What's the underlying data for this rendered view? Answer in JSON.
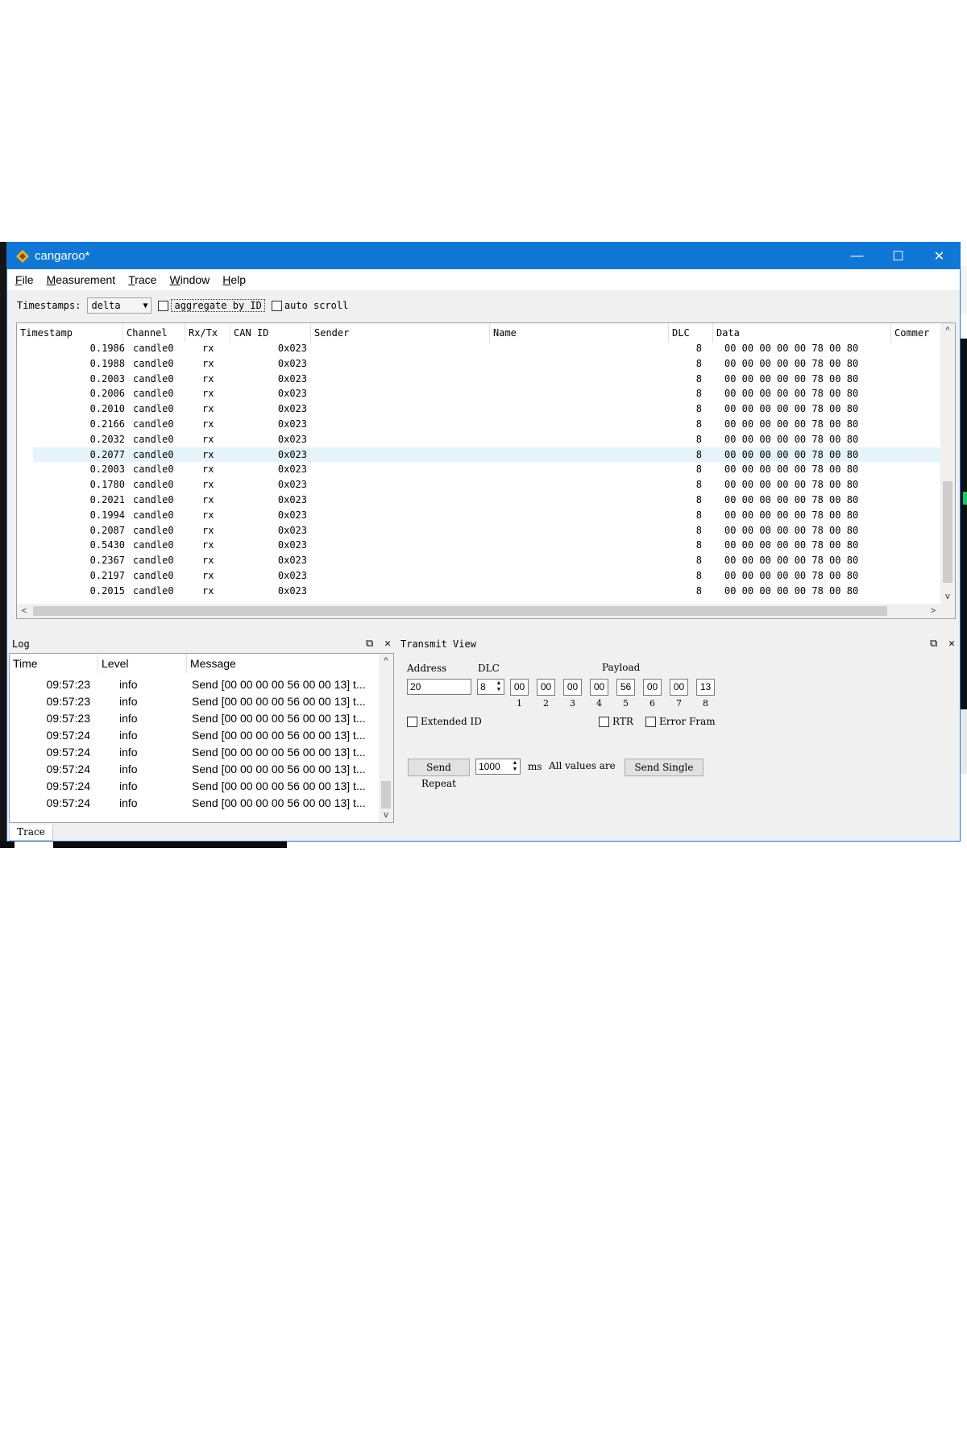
{
  "window": {
    "title": "cangaroo*"
  },
  "titlebar_buttons": {
    "minimize": "—",
    "maximize": "☐",
    "close": "✕"
  },
  "menu": [
    {
      "mnemonic": "F",
      "rest": "ile"
    },
    {
      "mnemonic": "M",
      "rest": "easurement"
    },
    {
      "mnemonic": "T",
      "rest": "race"
    },
    {
      "mnemonic": "W",
      "rest": "indow"
    },
    {
      "mnemonic": "H",
      "rest": "elp"
    }
  ],
  "toolbar": {
    "timestamps_label": "Timestamps:",
    "timestamps_value": "delta",
    "aggregate_label": "aggregate by ID",
    "autoscroll_label": "auto scroll"
  },
  "trace": {
    "columns": [
      "Timestamp",
      "Channel",
      "Rx/Tx",
      "CAN ID",
      "Sender",
      "Name",
      "DLC",
      "Data",
      "Commer"
    ],
    "rows": [
      {
        "ts": "0.1986",
        "ch": "candle0",
        "dir": "rx",
        "id": "0x023",
        "dlc": "8",
        "data": "00 00 00 00 00 78 00 80"
      },
      {
        "ts": "0.1988",
        "ch": "candle0",
        "dir": "rx",
        "id": "0x023",
        "dlc": "8",
        "data": "00 00 00 00 00 78 00 80"
      },
      {
        "ts": "0.2003",
        "ch": "candle0",
        "dir": "rx",
        "id": "0x023",
        "dlc": "8",
        "data": "00 00 00 00 00 78 00 80"
      },
      {
        "ts": "0.2006",
        "ch": "candle0",
        "dir": "rx",
        "id": "0x023",
        "dlc": "8",
        "data": "00 00 00 00 00 78 00 80"
      },
      {
        "ts": "0.2010",
        "ch": "candle0",
        "dir": "rx",
        "id": "0x023",
        "dlc": "8",
        "data": "00 00 00 00 00 78 00 80"
      },
      {
        "ts": "0.2166",
        "ch": "candle0",
        "dir": "rx",
        "id": "0x023",
        "dlc": "8",
        "data": "00 00 00 00 00 78 00 80"
      },
      {
        "ts": "0.2032",
        "ch": "candle0",
        "dir": "rx",
        "id": "0x023",
        "dlc": "8",
        "data": "00 00 00 00 00 78 00 80"
      },
      {
        "ts": "0.2077",
        "ch": "candle0",
        "dir": "rx",
        "id": "0x023",
        "dlc": "8",
        "data": "00 00 00 00 00 78 00 80",
        "selected": true
      },
      {
        "ts": "0.2003",
        "ch": "candle0",
        "dir": "rx",
        "id": "0x023",
        "dlc": "8",
        "data": "00 00 00 00 00 78 00 80"
      },
      {
        "ts": "0.1780",
        "ch": "candle0",
        "dir": "rx",
        "id": "0x023",
        "dlc": "8",
        "data": "00 00 00 00 00 78 00 80"
      },
      {
        "ts": "0.2021",
        "ch": "candle0",
        "dir": "rx",
        "id": "0x023",
        "dlc": "8",
        "data": "00 00 00 00 00 78 00 80"
      },
      {
        "ts": "0.1994",
        "ch": "candle0",
        "dir": "rx",
        "id": "0x023",
        "dlc": "8",
        "data": "00 00 00 00 00 78 00 80"
      },
      {
        "ts": "0.2087",
        "ch": "candle0",
        "dir": "rx",
        "id": "0x023",
        "dlc": "8",
        "data": "00 00 00 00 00 78 00 80"
      },
      {
        "ts": "0.5430",
        "ch": "candle0",
        "dir": "rx",
        "id": "0x023",
        "dlc": "8",
        "data": "00 00 00 00 00 78 00 80"
      },
      {
        "ts": "0.2367",
        "ch": "candle0",
        "dir": "rx",
        "id": "0x023",
        "dlc": "8",
        "data": "00 00 00 00 00 78 00 80"
      },
      {
        "ts": "0.2197",
        "ch": "candle0",
        "dir": "rx",
        "id": "0x023",
        "dlc": "8",
        "data": "00 00 00 00 00 78 00 80"
      },
      {
        "ts": "0.2015",
        "ch": "candle0",
        "dir": "rx",
        "id": "0x023",
        "dlc": "8",
        "data": "00 00 00 00 00 78 00 80"
      }
    ]
  },
  "log": {
    "title": "Log",
    "columns": [
      "Time",
      "Level",
      "Message"
    ],
    "rows": [
      {
        "time": "09:57:23",
        "level": "info",
        "msg": "Send [00 00 00 00 56 00 00 13] t..."
      },
      {
        "time": "09:57:23",
        "level": "info",
        "msg": "Send [00 00 00 00 56 00 00 13] t..."
      },
      {
        "time": "09:57:23",
        "level": "info",
        "msg": "Send [00 00 00 00 56 00 00 13] t..."
      },
      {
        "time": "09:57:24",
        "level": "info",
        "msg": "Send [00 00 00 00 56 00 00 13] t..."
      },
      {
        "time": "09:57:24",
        "level": "info",
        "msg": "Send [00 00 00 00 56 00 00 13] t..."
      },
      {
        "time": "09:57:24",
        "level": "info",
        "msg": "Send [00 00 00 00 56 00 00 13] t..."
      },
      {
        "time": "09:57:24",
        "level": "info",
        "msg": "Send [00 00 00 00 56 00 00 13] t..."
      },
      {
        "time": "09:57:24",
        "level": "info",
        "msg": "Send [00 00 00 00 56 00 00 13] t..."
      }
    ]
  },
  "transmit": {
    "title": "Transmit View",
    "address_label": "Address",
    "address_value": "20",
    "dlc_label": "DLC",
    "dlc_value": "8",
    "payload_label": "Payload",
    "payload": [
      "00",
      "00",
      "00",
      "00",
      "56",
      "00",
      "00",
      "13"
    ],
    "payload_indices": [
      "1",
      "2",
      "3",
      "4",
      "5",
      "6",
      "7",
      "8"
    ],
    "extended_id_label": "Extended ID",
    "rtr_label": "RTR",
    "error_frame_label": "Error Fram",
    "send_repeat_label": "Send Repeat",
    "interval_value": "1000",
    "interval_unit": "ms",
    "all_values_label": "All values are",
    "send_single_label": "Send Single"
  },
  "dock_buttons": {
    "float": "⧉",
    "close": "✕"
  },
  "bottom_tab": {
    "label": "Trace"
  },
  "colors": {
    "titlebar": "#0f78d7",
    "selected_row": "#e5f3fb",
    "app_icon": "#f2b21b"
  },
  "icons": {
    "app": "cangaroo-diamond-icon"
  }
}
